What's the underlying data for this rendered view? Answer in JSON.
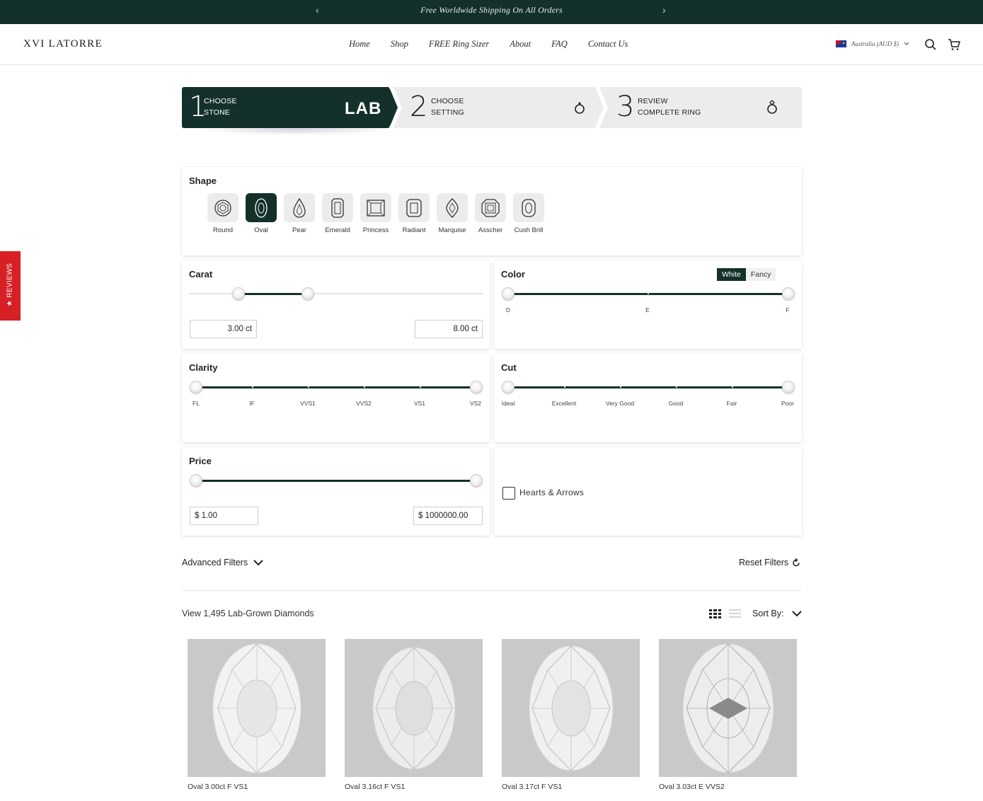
{
  "announcement": {
    "message": "Free Worldwide Shipping On All Orders",
    "prev": "‹",
    "next": "›"
  },
  "header": {
    "logo": "XVI LATORRE",
    "nav": [
      "Home",
      "Shop",
      "FREE Ring Sizer",
      "About",
      "FAQ",
      "Contact Us"
    ],
    "locale": "Australia (AUD $)",
    "icons": [
      "search-icon",
      "cart-icon"
    ]
  },
  "steps": [
    {
      "num": "1",
      "line1": "CHOOSE",
      "line2": "STONE",
      "badge": "LAB"
    },
    {
      "num": "2",
      "line1": "CHOOSE",
      "line2": "SETTING",
      "icon": "ring-icon"
    },
    {
      "num": "3",
      "line1": "REVIEW",
      "line2": "COMPLETE RING",
      "icon": "diamond-ring-icon"
    }
  ],
  "shape": {
    "title": "Shape",
    "selected": "Oval",
    "options": [
      "Round",
      "Oval",
      "Pear",
      "Emerald",
      "Princess",
      "Radiant",
      "Marquise",
      "Asscher",
      "Cush Brill"
    ]
  },
  "carat": {
    "title": "Carat",
    "min_value": "3.00 ct",
    "max_value": "8.00 ct"
  },
  "color": {
    "title": "Color",
    "toggle": [
      "White",
      "Fancy"
    ],
    "active_toggle": "White",
    "labels": [
      "D",
      "E",
      "F"
    ]
  },
  "clarity": {
    "title": "Clarity",
    "labels": [
      "FL",
      "IF",
      "VVS1",
      "VVS2",
      "VS1",
      "VS2"
    ]
  },
  "cut": {
    "title": "Cut",
    "labels": [
      "Ideal",
      "Excellent",
      "Very Good",
      "Good",
      "Fair",
      "Poor"
    ]
  },
  "price": {
    "title": "Price",
    "min_value": "$ 1.00",
    "max_value": "$ 1000000.00"
  },
  "hearts": {
    "label": "Hearts & Arrows",
    "checked": false
  },
  "filters": {
    "advanced": "Advanced Filters",
    "reset": "Reset Filters"
  },
  "results": {
    "count": "View 1,495 Lab-Grown Diamonds",
    "sort": "Sort By:"
  },
  "products": [
    {
      "caption": "Oval 3.00ct F VS1"
    },
    {
      "caption": "Oval 3.16ct F VS1"
    },
    {
      "caption": "Oval 3.17ct F VS1"
    },
    {
      "caption": "Oval 3.03ct E VVS2"
    }
  ],
  "reviews_tab": "★ REVIEWS",
  "colors": {
    "brand": "#13302a",
    "reviews": "#d71f26"
  }
}
